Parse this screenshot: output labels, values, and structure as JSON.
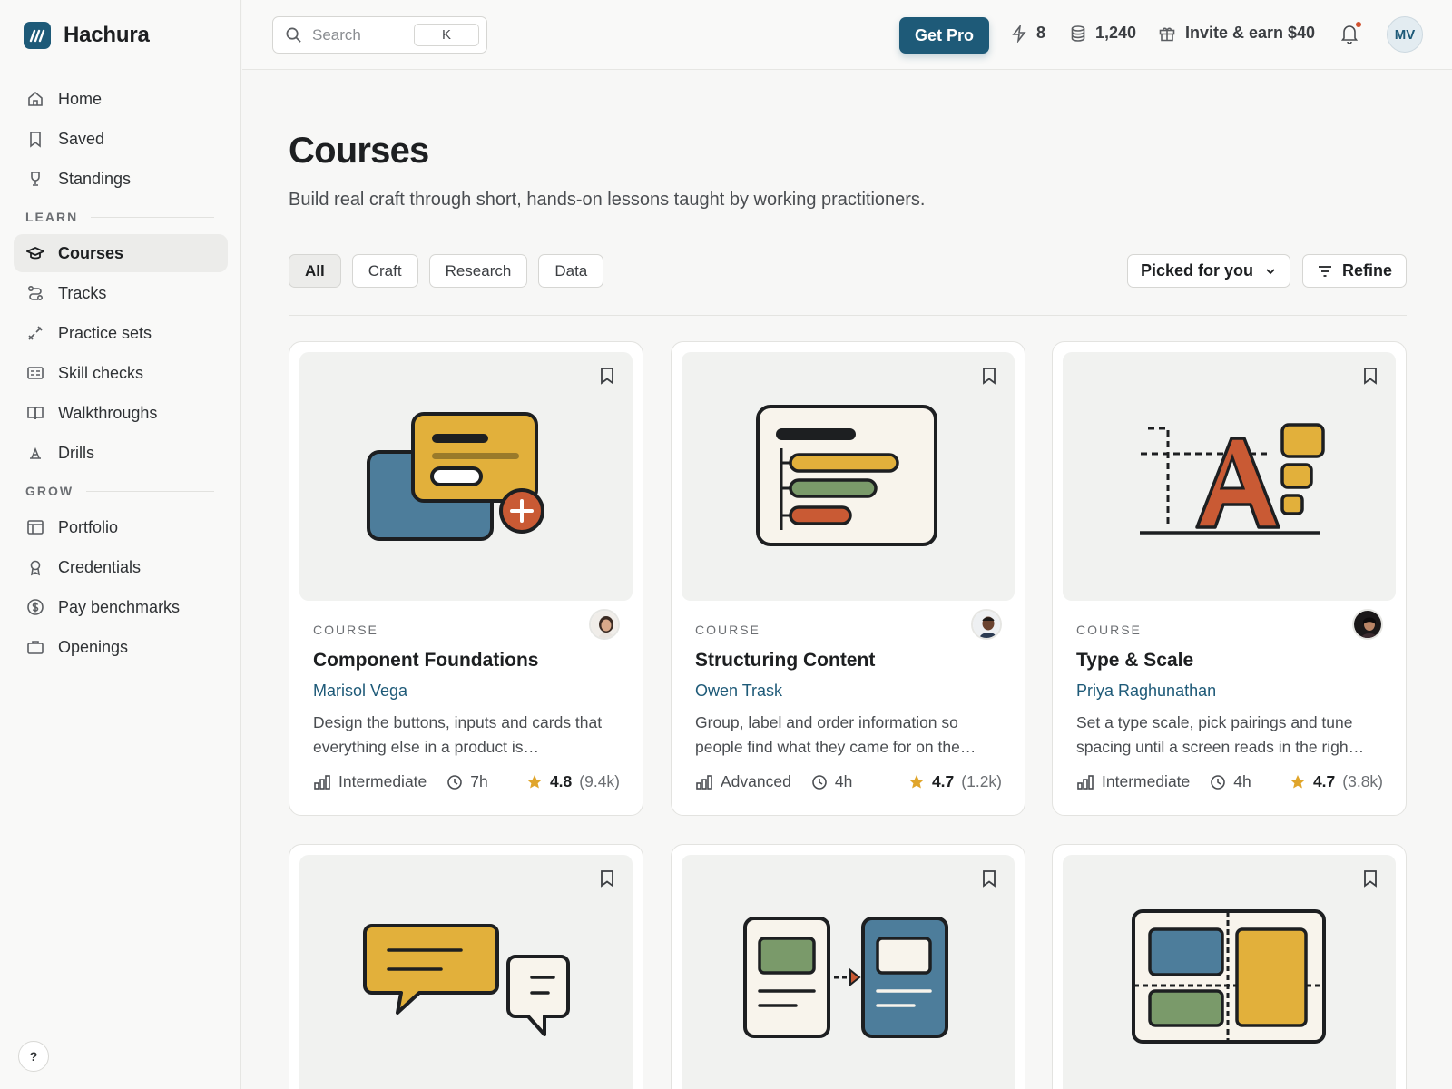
{
  "brand": {
    "name": "Hachura"
  },
  "sidebar": {
    "main_items": [
      {
        "label": "Home",
        "icon": "home-icon"
      },
      {
        "label": "Saved",
        "icon": "bookmark-icon"
      },
      {
        "label": "Standings",
        "icon": "trophy-icon"
      }
    ],
    "learn_section": "LEARN",
    "learn_items": [
      {
        "label": "Courses",
        "icon": "graduation-cap-icon",
        "active": true
      },
      {
        "label": "Tracks",
        "icon": "route-icon"
      },
      {
        "label": "Practice sets",
        "icon": "tools-icon"
      },
      {
        "label": "Skill checks",
        "icon": "checklist-icon"
      },
      {
        "label": "Walkthroughs",
        "icon": "open-book-icon"
      },
      {
        "label": "Drills",
        "icon": "drill-icon"
      }
    ],
    "grow_section": "GROW",
    "grow_items": [
      {
        "label": "Portfolio",
        "icon": "layout-icon"
      },
      {
        "label": "Credentials",
        "icon": "award-icon"
      },
      {
        "label": "Pay benchmarks",
        "icon": "dollar-icon"
      },
      {
        "label": "Openings",
        "icon": "briefcase-icon"
      }
    ],
    "help_label": "?"
  },
  "topbar": {
    "search_placeholder": "Search",
    "search_shortcut": "K",
    "get_pro": "Get Pro",
    "streak": "8",
    "coins": "1,240",
    "invite": "Invite & earn $40",
    "user_initials": "MV"
  },
  "page": {
    "title": "Courses",
    "subtitle": "Build real craft through short, hands-on lessons taught by working practitioners.",
    "filters": [
      "All",
      "Craft",
      "Research",
      "Data"
    ],
    "active_filter": "All",
    "sort": "Picked for you",
    "refine": "Refine"
  },
  "courses": [
    {
      "type": "COURSE",
      "title": "Component Foundations",
      "author": "Marisol Vega",
      "desc": "Design the buttons, inputs and cards that everything else in a product is…",
      "level": "Intermediate",
      "duration": "7h",
      "rating": "4.8",
      "reviews": "(9.4k)"
    },
    {
      "type": "COURSE",
      "title": "Structuring Content",
      "author": "Owen Trask",
      "desc": "Group, label and order information so people find what they came for on the…",
      "level": "Advanced",
      "duration": "4h",
      "rating": "4.7",
      "reviews": "(1.2k)"
    },
    {
      "type": "COURSE",
      "title": "Type & Scale",
      "author": "Priya Raghunathan",
      "desc": "Set a type scale, pick pairings and tune spacing until a screen reads in the righ…",
      "level": "Intermediate",
      "duration": "4h",
      "rating": "4.7",
      "reviews": "(3.8k)"
    }
  ],
  "colors": {
    "accent": "#1e5a78",
    "yellow": "#e2b03b",
    "blue": "#4d7d9b",
    "green": "#7a9a6a",
    "orange": "#c95a34",
    "star": "#e0a52b"
  }
}
